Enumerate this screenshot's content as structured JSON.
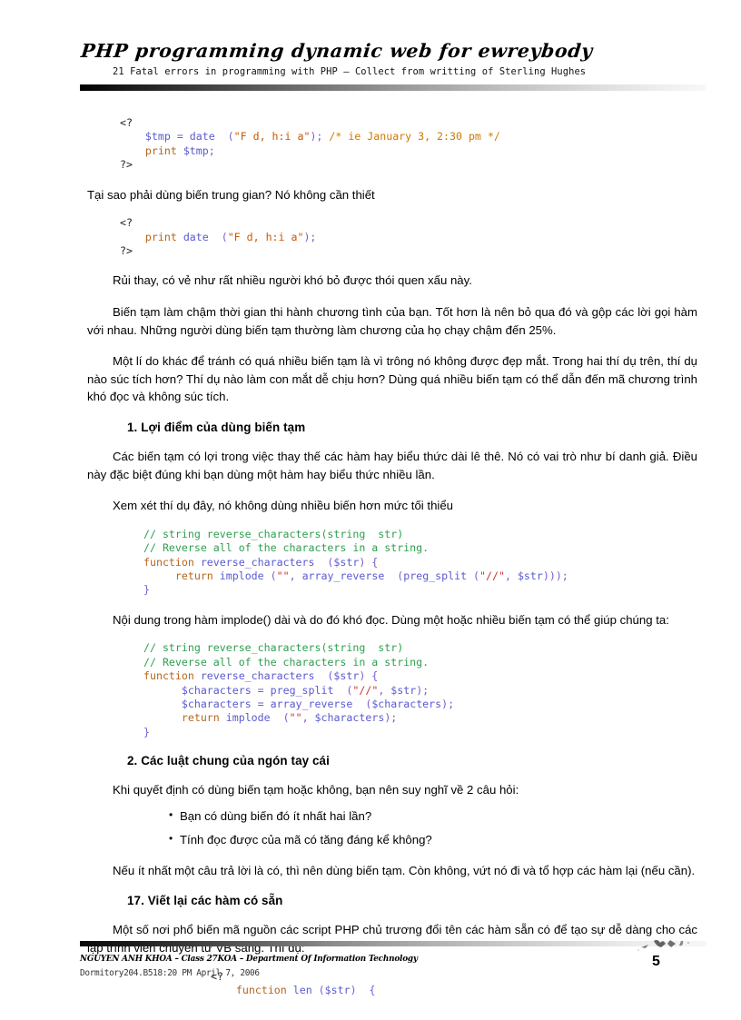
{
  "document": {
    "header": {
      "title": "PHP programming dynamic web for ewreybody",
      "subtitle": "21 Fatal errors in programming with PHP  –  Collect from writting of Sterling Hughes"
    },
    "footer": {
      "organization": "NGUYEN ANH KHOA – Class 27KOA – Department Of Information Technology",
      "timestamp": "Dormitory204.B518:20 PM April 7, 2006",
      "page_number": "5"
    },
    "blocks": [
      {
        "id": "code-1",
        "type": "code",
        "lines": [
          [
            {
              "t": "<?",
              "c": "plain"
            }
          ],
          [
            {
              "t": "    ",
              "c": "plain"
            },
            {
              "t": "$tmp",
              "c": "var"
            },
            {
              "t": " = ",
              "c": "punct"
            },
            {
              "t": "date",
              "c": "func"
            },
            {
              "t": "  (",
              "c": "punct"
            },
            {
              "t": "\"F d, h:i a\"",
              "c": "str"
            },
            {
              "t": "); ",
              "c": "punct"
            },
            {
              "t": "/* ie January 3, 2:30 pm */",
              "c": "comment"
            }
          ],
          [
            {
              "t": "    ",
              "c": "plain"
            },
            {
              "t": "print",
              "c": "kw"
            },
            {
              "t": " ",
              "c": "plain"
            },
            {
              "t": "$tmp",
              "c": "var"
            },
            {
              "t": ";",
              "c": "punct"
            }
          ],
          [
            {
              "t": "?>",
              "c": "plain"
            }
          ]
        ]
      },
      {
        "id": "para-1",
        "type": "paragraph",
        "indent": false,
        "text": "Tại sao phải dùng biến trung gian? Nó không cần thiết"
      },
      {
        "id": "code-2",
        "type": "code",
        "lines": [
          [
            {
              "t": "<?",
              "c": "plain"
            }
          ],
          [
            {
              "t": "    ",
              "c": "plain"
            },
            {
              "t": "print",
              "c": "kw"
            },
            {
              "t": " ",
              "c": "plain"
            },
            {
              "t": "date",
              "c": "func"
            },
            {
              "t": "  (",
              "c": "punct"
            },
            {
              "t": "\"F d, h:i a\"",
              "c": "str"
            },
            {
              "t": ");",
              "c": "punct"
            }
          ],
          [
            {
              "t": "?>",
              "c": "plain"
            }
          ]
        ]
      },
      {
        "id": "para-2",
        "type": "paragraph",
        "text": "Rủi thay, có vẻ như rất nhiều người khó bỏ được thói quen xấu này."
      },
      {
        "id": "para-3",
        "type": "paragraph",
        "text": "Biến tạm làm chậm thời gian thi hành chương tình của bạn. Tốt hơn là nên bỏ qua đó và gộp các lời gọi hàm với nhau. Những người dùng biến tạm thường làm chương của họ chạy chậm đến 25%."
      },
      {
        "id": "para-4",
        "type": "paragraph",
        "text": "Một lí do khác để tránh có quá nhiều biến tạm là vì trông nó không được đẹp mắt. Trong hai thí dụ trên, thí dụ nào súc tích hơn? Thí dụ nào làm con mắt dễ chịu hơn? Dùng quá nhiều biến tạm có thể dẫn đến mã chương trình khó đọc và không súc tích."
      },
      {
        "id": "heading-1",
        "type": "heading",
        "text": "1. Lợi điểm của dùng biến tạm"
      },
      {
        "id": "para-5",
        "type": "paragraph",
        "text": "Các biến tạm có lợi trong việc thay thế các hàm hay biểu thức dài lê thê. Nó có vai trò như bí danh giả. Điều này đặc biệt đúng khi bạn dùng một hàm hay biểu thức nhiều lần."
      },
      {
        "id": "para-6",
        "type": "paragraph",
        "text": "Xem xét thí dụ đây, nó không dùng nhiều biến hơn mức tối thiểu"
      },
      {
        "id": "code-3",
        "type": "code",
        "lines": [
          [
            {
              "t": "// string reverse_characters(string  str)",
              "c": "comment-green"
            }
          ],
          [
            {
              "t": "// Reverse all of the characters in a string.",
              "c": "comment-green"
            }
          ],
          [
            {
              "t": "function",
              "c": "kw"
            },
            {
              "t": " ",
              "c": "plain"
            },
            {
              "t": "reverse_characters",
              "c": "func"
            },
            {
              "t": "  (",
              "c": "punct"
            },
            {
              "t": "$str",
              "c": "var"
            },
            {
              "t": ") {",
              "c": "punct"
            }
          ],
          [
            {
              "t": "     ",
              "c": "plain"
            },
            {
              "t": "return",
              "c": "kw"
            },
            {
              "t": " ",
              "c": "plain"
            },
            {
              "t": "implode",
              "c": "func"
            },
            {
              "t": " (",
              "c": "punct"
            },
            {
              "t": "\"\"",
              "c": "str2"
            },
            {
              "t": ", ",
              "c": "punct"
            },
            {
              "t": "array_reverse",
              "c": "func"
            },
            {
              "t": "  (",
              "c": "punct"
            },
            {
              "t": "preg_split",
              "c": "func"
            },
            {
              "t": " (",
              "c": "punct"
            },
            {
              "t": "\"//\"",
              "c": "str2"
            },
            {
              "t": ", ",
              "c": "punct"
            },
            {
              "t": "$str",
              "c": "var"
            },
            {
              "t": ")));",
              "c": "punct"
            }
          ],
          [
            {
              "t": "}",
              "c": "punct"
            }
          ]
        ]
      },
      {
        "id": "para-7",
        "type": "paragraph",
        "text": "Nội dung trong hàm implode() dài và do đó khó đọc. Dùng một hoặc nhiều biến tạm có thể giúp chúng ta:"
      },
      {
        "id": "code-4",
        "type": "code",
        "lines": [
          [
            {
              "t": "// string reverse_characters(string  str)",
              "c": "comment-green"
            }
          ],
          [
            {
              "t": "// Reverse all of the characters in a string.",
              "c": "comment-green"
            }
          ],
          [
            {
              "t": "function",
              "c": "kw"
            },
            {
              "t": " ",
              "c": "plain"
            },
            {
              "t": "reverse_characters",
              "c": "func"
            },
            {
              "t": "  (",
              "c": "punct"
            },
            {
              "t": "$str",
              "c": "var"
            },
            {
              "t": ") {",
              "c": "punct"
            }
          ],
          [
            {
              "t": "      ",
              "c": "plain"
            },
            {
              "t": "$characters",
              "c": "var"
            },
            {
              "t": " = ",
              "c": "punct"
            },
            {
              "t": "preg_split",
              "c": "func"
            },
            {
              "t": "  (",
              "c": "punct"
            },
            {
              "t": "\"//\"",
              "c": "str2"
            },
            {
              "t": ", ",
              "c": "punct"
            },
            {
              "t": "$str",
              "c": "var"
            },
            {
              "t": ");",
              "c": "punct"
            }
          ],
          [
            {
              "t": "      ",
              "c": "plain"
            },
            {
              "t": "$characters",
              "c": "var"
            },
            {
              "t": " = ",
              "c": "punct"
            },
            {
              "t": "array_reverse",
              "c": "func"
            },
            {
              "t": "  (",
              "c": "punct"
            },
            {
              "t": "$characters",
              "c": "var"
            },
            {
              "t": ");",
              "c": "punct"
            }
          ],
          [
            {
              "t": "      ",
              "c": "plain"
            },
            {
              "t": "return",
              "c": "kw"
            },
            {
              "t": " ",
              "c": "plain"
            },
            {
              "t": "implode",
              "c": "func"
            },
            {
              "t": "  (",
              "c": "punct"
            },
            {
              "t": "\"\"",
              "c": "str2"
            },
            {
              "t": ", ",
              "c": "punct"
            },
            {
              "t": "$characters",
              "c": "var"
            },
            {
              "t": ");",
              "c": "punct"
            }
          ],
          [
            {
              "t": "}",
              "c": "punct"
            }
          ]
        ]
      },
      {
        "id": "heading-2",
        "type": "heading",
        "text": "2. Các luật chung của ngón tay cái"
      },
      {
        "id": "para-8",
        "type": "paragraph",
        "text": "Khi quyết định có dùng biến tạm hoặc không, bạn nên suy nghĩ về 2 câu hỏi:"
      },
      {
        "id": "bullets-1",
        "type": "bullets",
        "items": [
          "Bạn có dùng biến đó ít nhất hai lần?",
          "Tính đọc được của mã có tăng đáng kể không?"
        ]
      },
      {
        "id": "para-9",
        "type": "paragraph",
        "text": "Nếu ít nhất một câu trả lời là có, thì nên dùng biến tạm. Còn không, vứt nó đi và tổ hợp các hàm lại (nếu cần)."
      },
      {
        "id": "heading-3",
        "type": "heading",
        "text": "17. Viết lại các hàm có sẵn"
      },
      {
        "id": "para-10",
        "type": "paragraph",
        "text": "Một số nơi phổ biến mã nguồn các script PHP chủ trương đổi tên các hàm sẵn có để tạo sự dễ dàng cho các lập trình viên chuyển từ VB sang. Thí dụ:"
      },
      {
        "id": "code-5",
        "type": "code",
        "lines": [
          [
            {
              "t": "<?",
              "c": "plain"
            }
          ],
          [
            {
              "t": "    ",
              "c": "plain"
            },
            {
              "t": "function",
              "c": "kw"
            },
            {
              "t": " ",
              "c": "plain"
            },
            {
              "t": "len",
              "c": "func"
            },
            {
              "t": " (",
              "c": "punct"
            },
            {
              "t": "$str",
              "c": "var"
            },
            {
              "t": ")  {",
              "c": "punct"
            }
          ]
        ]
      }
    ]
  },
  "colors": {
    "text": "#000000",
    "code_variable": "#5a5ad0",
    "code_keyword": "#b5651d",
    "code_string": "#cc5500",
    "code_comment_orange": "#cc7a00",
    "code_comment_green": "#2e9e4f",
    "background": "#ffffff"
  }
}
